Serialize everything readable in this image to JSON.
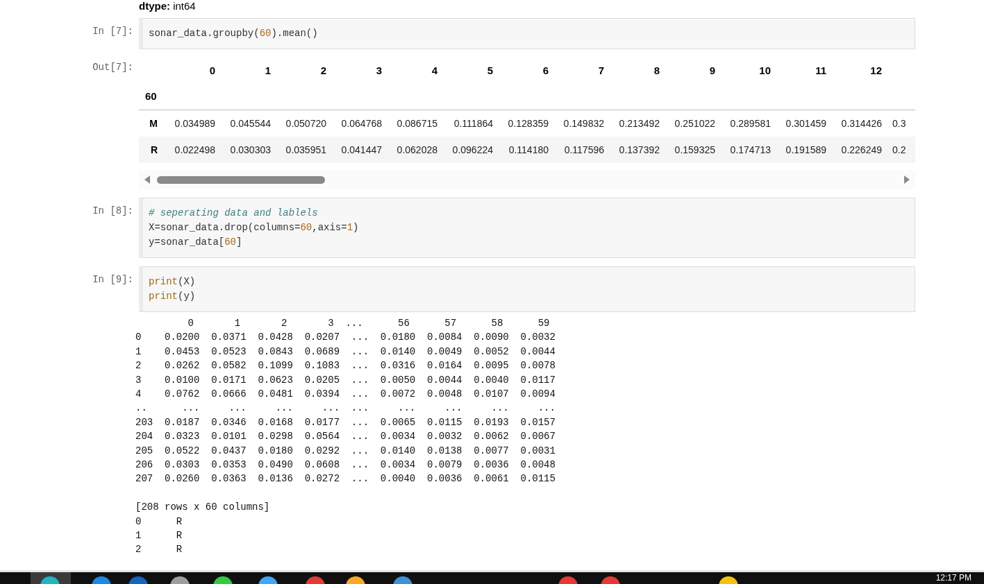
{
  "previous_output": {
    "text": "**dtype:** int64"
  },
  "cells": [
    {
      "prompt": "In [7]:",
      "code": [
        [
          {
            "text": "sonar_data.groupby(",
            "kind": "plain"
          },
          {
            "text": "60",
            "kind": "number"
          },
          {
            "text": ").mean()",
            "kind": "plain"
          }
        ]
      ],
      "output": {
        "kind": "dataframe",
        "prompt": "Out[7]:",
        "columns": [
          "0",
          "1",
          "2",
          "3",
          "4",
          "5",
          "6",
          "7",
          "8",
          "9",
          "10",
          "11",
          "12"
        ],
        "index_name": "60",
        "rows": [
          {
            "label": "M",
            "values": [
              "0.034989",
              "0.045544",
              "0.050720",
              "0.064768",
              "0.086715",
              "0.111864",
              "0.128359",
              "0.149832",
              "0.213492",
              "0.251022",
              "0.289581",
              "0.301459",
              "0.314426",
              "0.3"
            ]
          },
          {
            "label": "R",
            "values": [
              "0.022498",
              "0.030303",
              "0.035951",
              "0.041447",
              "0.062028",
              "0.096224",
              "0.114180",
              "0.117596",
              "0.137392",
              "0.159325",
              "0.174713",
              "0.191589",
              "0.226249",
              "0.2"
            ]
          }
        ]
      }
    },
    {
      "prompt": "In [8]:",
      "code": [
        [
          {
            "text": "# seperating data and lablels",
            "kind": "comment"
          }
        ],
        [
          {
            "text": "X=sonar_data.drop(columns=",
            "kind": "plain"
          },
          {
            "text": "60",
            "kind": "number"
          },
          {
            "text": ",axis=",
            "kind": "plain"
          },
          {
            "text": "1",
            "kind": "number"
          },
          {
            "text": ")",
            "kind": "plain"
          }
        ],
        [
          {
            "text": "y=sonar_data[",
            "kind": "plain"
          },
          {
            "text": "60",
            "kind": "number"
          },
          {
            "text": "]",
            "kind": "plain"
          }
        ]
      ]
    },
    {
      "prompt": "In [9]:",
      "code": [
        [
          {
            "text": "print",
            "kind": "builtin"
          },
          {
            "text": "(X)",
            "kind": "plain"
          }
        ],
        [
          {
            "text": "print",
            "kind": "builtin"
          },
          {
            "text": "(y)",
            "kind": "plain"
          }
        ]
      ],
      "output": {
        "kind": "stream",
        "lines": [
          "         0       1       2       3  ...      56      57      58      59",
          "0    0.0200  0.0371  0.0428  0.0207  ...  0.0180  0.0084  0.0090  0.0032",
          "1    0.0453  0.0523  0.0843  0.0689  ...  0.0140  0.0049  0.0052  0.0044",
          "2    0.0262  0.0582  0.1099  0.1083  ...  0.0316  0.0164  0.0095  0.0078",
          "3    0.0100  0.0171  0.0623  0.0205  ...  0.0050  0.0044  0.0040  0.0117",
          "4    0.0762  0.0666  0.0481  0.0394  ...  0.0072  0.0048  0.0107  0.0094",
          "..      ...     ...     ...     ...  ...     ...     ...     ...     ...",
          "203  0.0187  0.0346  0.0168  0.0177  ...  0.0065  0.0115  0.0193  0.0157",
          "204  0.0323  0.0101  0.0298  0.0564  ...  0.0034  0.0032  0.0062  0.0067",
          "205  0.0522  0.0437  0.0180  0.0292  ...  0.0140  0.0138  0.0077  0.0031",
          "206  0.0303  0.0353  0.0490  0.0608  ...  0.0034  0.0079  0.0036  0.0048",
          "207  0.0260  0.0363  0.0136  0.0272  ...  0.0040  0.0036  0.0061  0.0115"
        ],
        "footer_lines": [
          "[208 rows x 60 columns]",
          "0      R",
          "1      R",
          "2      R"
        ]
      }
    }
  ],
  "taskbar": {
    "clock": "12:17 PM"
  }
}
